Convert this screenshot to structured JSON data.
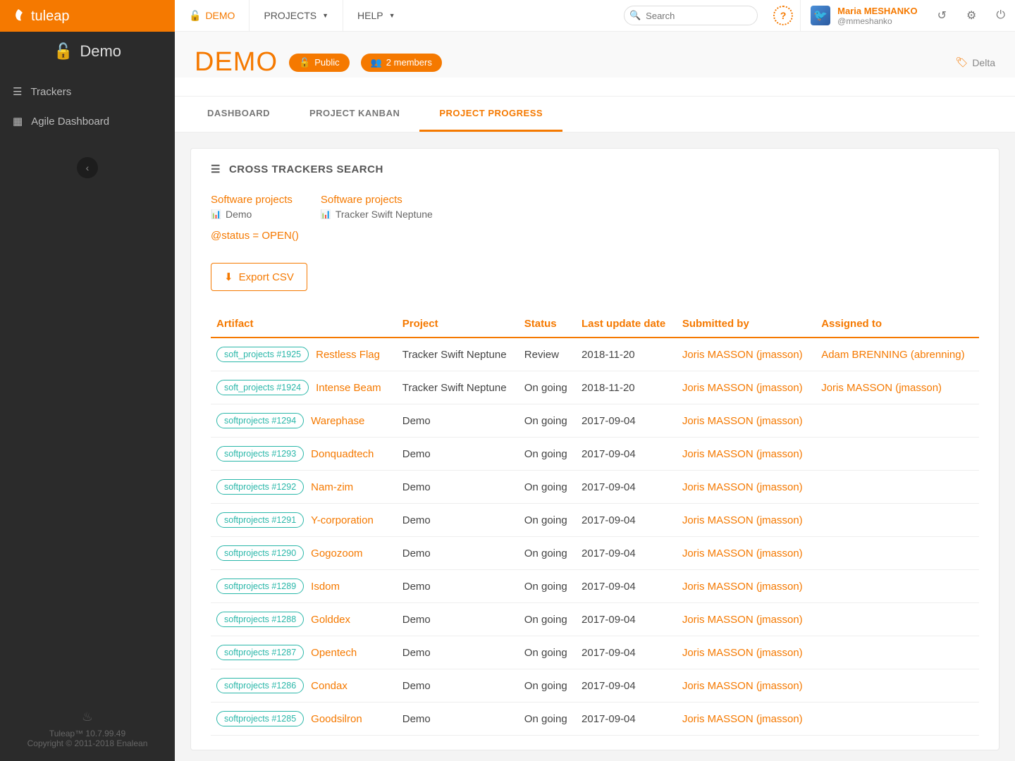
{
  "brand": "tuleap",
  "sidebar": {
    "project": "Demo",
    "items": [
      {
        "label": "Trackers"
      },
      {
        "label": "Agile Dashboard"
      }
    ],
    "version": "Tuleap™ 10.7.99.49",
    "copyright": "Copyright © 2011-2018 Enalean"
  },
  "topbar": {
    "current": "DEMO",
    "projects": "PROJECTS",
    "help": "HELP",
    "search_placeholder": "Search"
  },
  "user": {
    "name": "Maria MESHANKO",
    "login": "@mmeshanko"
  },
  "header": {
    "title": "DEMO",
    "public": "Public",
    "members": "2 members",
    "tag": "Delta"
  },
  "tabs": [
    {
      "label": "DASHBOARD",
      "active": false
    },
    {
      "label": "PROJECT KANBAN",
      "active": false
    },
    {
      "label": "PROJECT PROGRESS",
      "active": true
    }
  ],
  "card": {
    "title": "CROSS TRACKERS SEARCH",
    "filters": [
      {
        "title": "Software projects",
        "sub": "Demo"
      },
      {
        "title": "Software projects",
        "sub": "Tracker Swift Neptune"
      }
    ],
    "query": "@status = OPEN()",
    "export": "Export CSV",
    "columns": [
      "Artifact",
      "Project",
      "Status",
      "Last update date",
      "Submitted by",
      "Assigned to"
    ],
    "rows": [
      {
        "badge": "soft_projects #1925",
        "title": "Restless Flag",
        "project": "Tracker Swift Neptune",
        "status": "Review",
        "date": "2018-11-20",
        "submitter": "Joris MASSON (jmasson)",
        "assignee": "Adam BRENNING (abrenning)"
      },
      {
        "badge": "soft_projects #1924",
        "title": "Intense Beam",
        "project": "Tracker Swift Neptune",
        "status": "On going",
        "date": "2018-11-20",
        "submitter": "Joris MASSON (jmasson)",
        "assignee": "Joris MASSON (jmasson)"
      },
      {
        "badge": "softprojects #1294",
        "title": "Warephase",
        "project": "Demo",
        "status": "On going",
        "date": "2017-09-04",
        "submitter": "Joris MASSON (jmasson)",
        "assignee": ""
      },
      {
        "badge": "softprojects #1293",
        "title": "Donquadtech",
        "project": "Demo",
        "status": "On going",
        "date": "2017-09-04",
        "submitter": "Joris MASSON (jmasson)",
        "assignee": ""
      },
      {
        "badge": "softprojects #1292",
        "title": "Nam-zim",
        "project": "Demo",
        "status": "On going",
        "date": "2017-09-04",
        "submitter": "Joris MASSON (jmasson)",
        "assignee": ""
      },
      {
        "badge": "softprojects #1291",
        "title": "Y-corporation",
        "project": "Demo",
        "status": "On going",
        "date": "2017-09-04",
        "submitter": "Joris MASSON (jmasson)",
        "assignee": ""
      },
      {
        "badge": "softprojects #1290",
        "title": "Gogozoom",
        "project": "Demo",
        "status": "On going",
        "date": "2017-09-04",
        "submitter": "Joris MASSON (jmasson)",
        "assignee": ""
      },
      {
        "badge": "softprojects #1289",
        "title": "Isdom",
        "project": "Demo",
        "status": "On going",
        "date": "2017-09-04",
        "submitter": "Joris MASSON (jmasson)",
        "assignee": ""
      },
      {
        "badge": "softprojects #1288",
        "title": "Golddex",
        "project": "Demo",
        "status": "On going",
        "date": "2017-09-04",
        "submitter": "Joris MASSON (jmasson)",
        "assignee": ""
      },
      {
        "badge": "softprojects #1287",
        "title": "Opentech",
        "project": "Demo",
        "status": "On going",
        "date": "2017-09-04",
        "submitter": "Joris MASSON (jmasson)",
        "assignee": ""
      },
      {
        "badge": "softprojects #1286",
        "title": "Condax",
        "project": "Demo",
        "status": "On going",
        "date": "2017-09-04",
        "submitter": "Joris MASSON (jmasson)",
        "assignee": ""
      },
      {
        "badge": "softprojects #1285",
        "title": "Goodsilron",
        "project": "Demo",
        "status": "On going",
        "date": "2017-09-04",
        "submitter": "Joris MASSON (jmasson)",
        "assignee": ""
      }
    ]
  }
}
